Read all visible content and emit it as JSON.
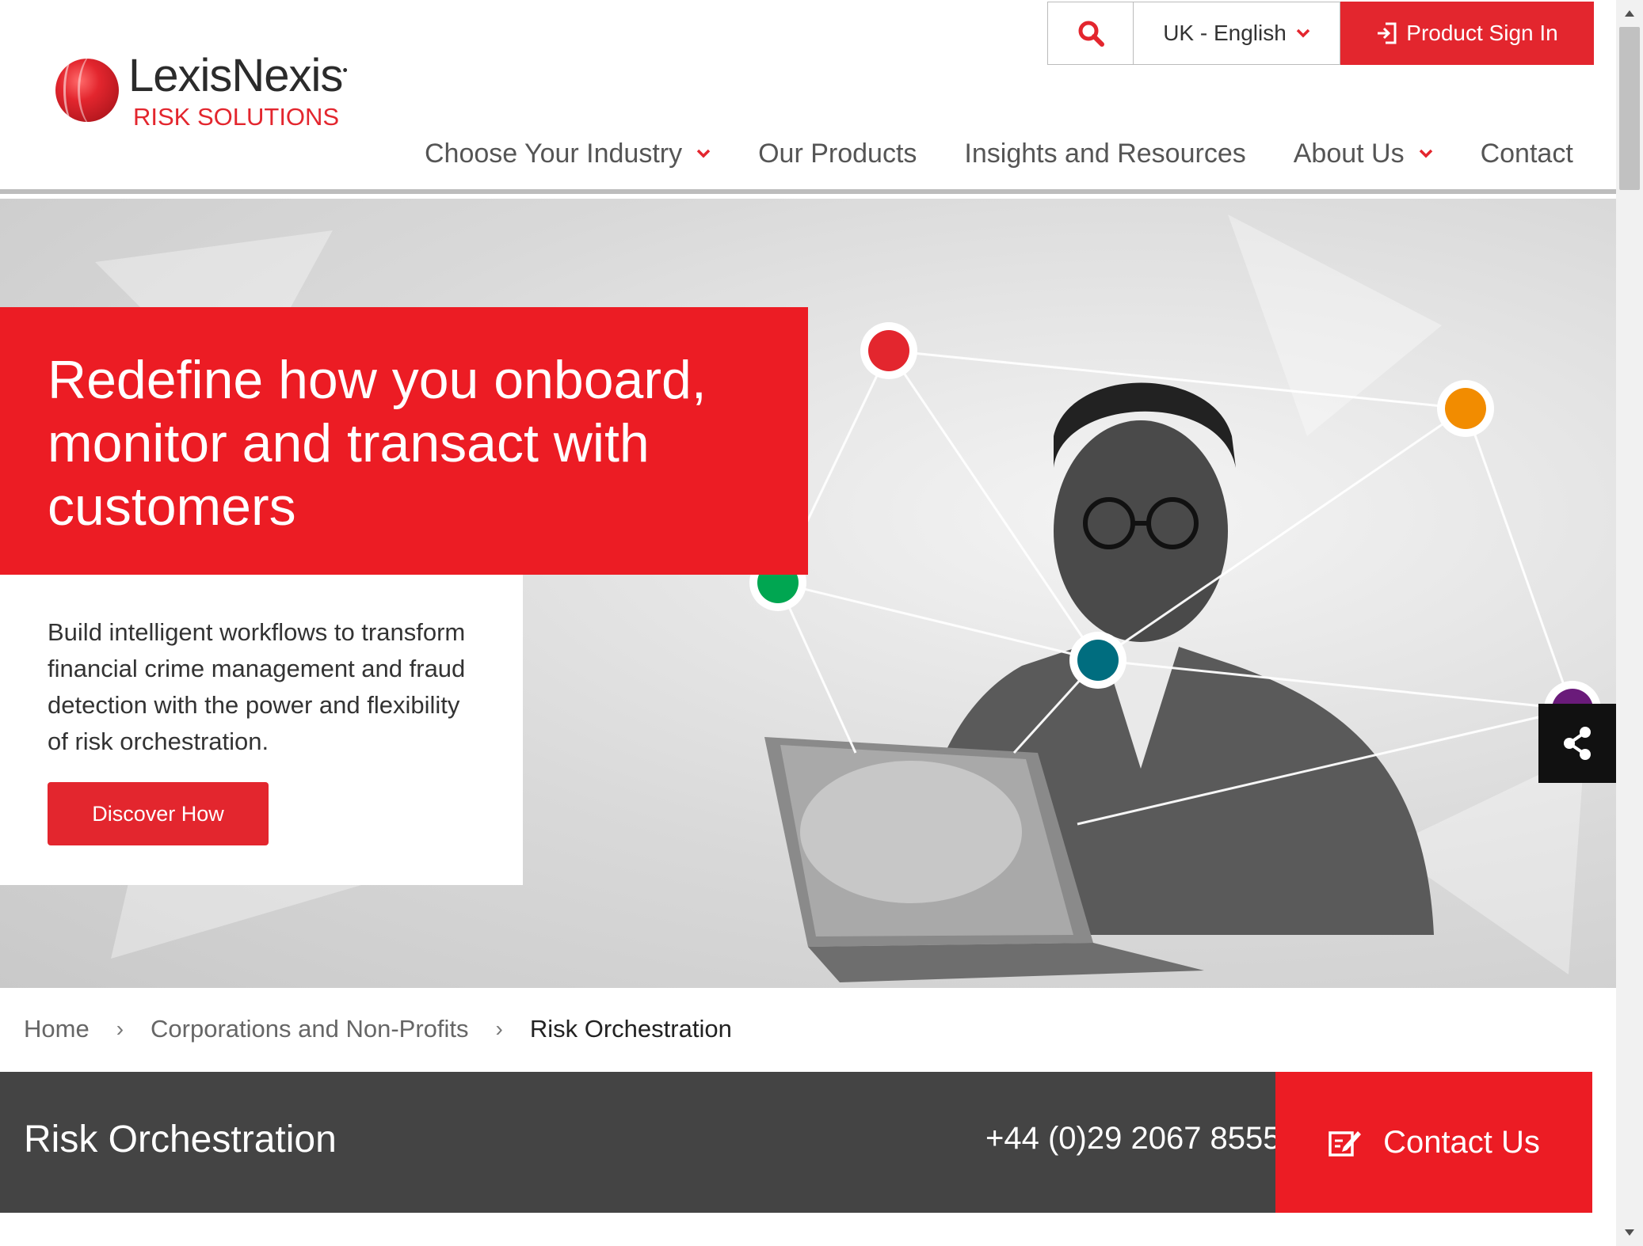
{
  "header": {
    "logo": {
      "name": "LexisNexis",
      "registered": "•",
      "subtitle": "RISK SOLUTIONS"
    },
    "utility": {
      "search_icon": "search-icon",
      "language": "UK - English",
      "signin_label": "Product Sign In"
    },
    "nav": {
      "industry": "Choose Your Industry",
      "products": "Our Products",
      "insights": "Insights and Resources",
      "about": "About Us",
      "contact": "Contact"
    }
  },
  "hero": {
    "title": "Redefine how you onboard, monitor and transact with customers",
    "description": "Build intelligent workflows to transform financial crime management and fraud detection with the power and flexibility of risk orchestration.",
    "cta_label": "Discover How",
    "node_colors": {
      "red": "#e3262e",
      "orange": "#f28c00",
      "green": "#00a651",
      "teal": "#006d7f",
      "purple": "#6a1b7a"
    }
  },
  "breadcrumb": {
    "home": "Home",
    "section": "Corporations and Non-Profits",
    "current": "Risk Orchestration",
    "separator": "›"
  },
  "page_bar": {
    "title": "Risk Orchestration",
    "phone": "+44 (0)29 2067 8555",
    "contact_label": "Contact Us"
  },
  "colors": {
    "brand_red": "#e3262e",
    "dark_bar": "#444444",
    "share_bg": "#111111"
  }
}
